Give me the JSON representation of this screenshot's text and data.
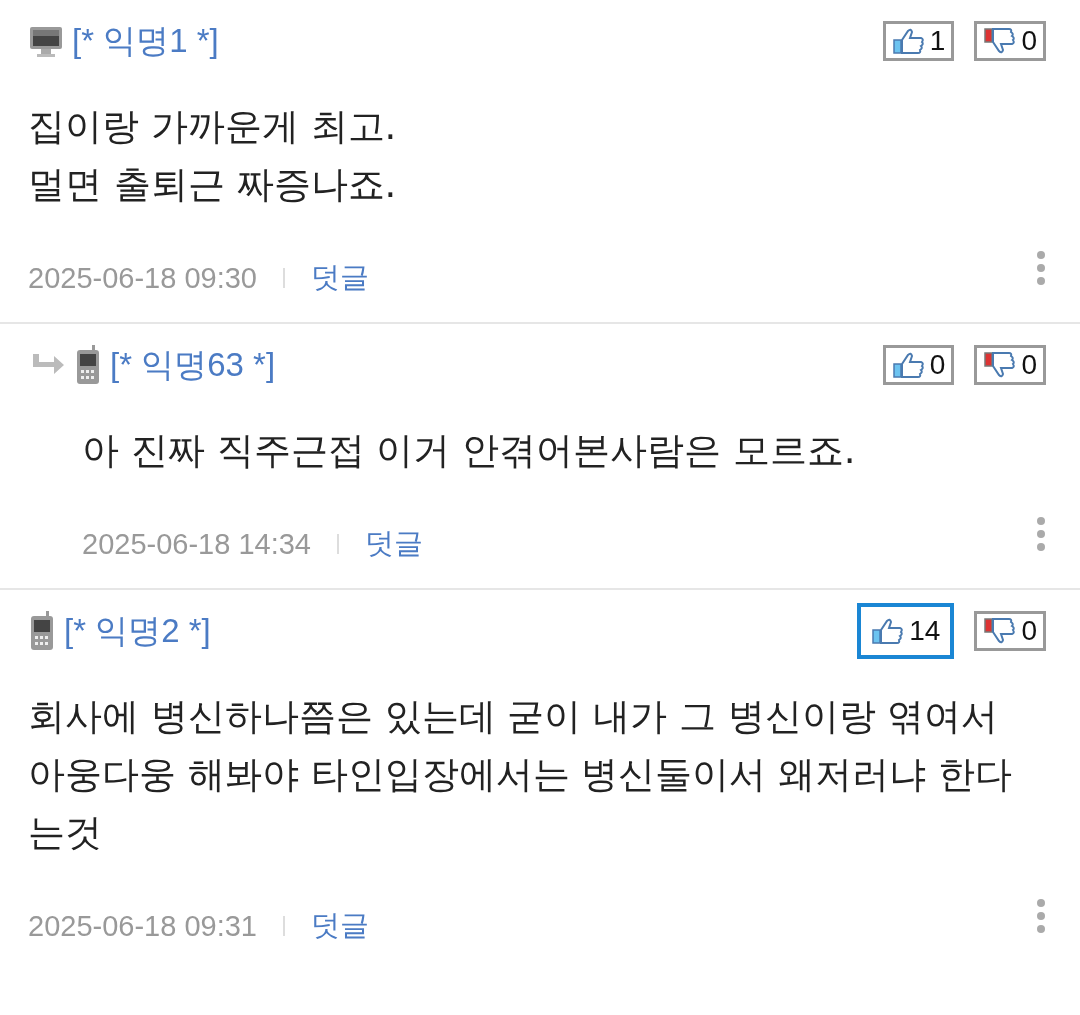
{
  "comments": [
    {
      "kind": "comment",
      "device": {
        "kind": "pc"
      },
      "author": "[* 익명1 *]",
      "likes": {
        "count": "1",
        "selected": false
      },
      "dislikes": {
        "count": "0",
        "selected": false
      },
      "body": [
        "집이랑 가까운게 최고.",
        "멀면 출퇴근 짜증나죠."
      ],
      "date": "2025-06-18 09:30",
      "reply": "덧글"
    },
    {
      "kind": "reply",
      "device": {
        "kind": "mobile"
      },
      "author": "[* 익명63 *]",
      "likes": {
        "count": "0",
        "selected": false
      },
      "dislikes": {
        "count": "0",
        "selected": false
      },
      "body": [
        "아 진짜 직주근접 이거 안겪어본사람은 모르죠."
      ],
      "date": "2025-06-18 14:34",
      "reply": "덧글"
    },
    {
      "kind": "comment",
      "device": {
        "kind": "mobile"
      },
      "author": "[* 익명2 *]",
      "likes": {
        "count": "14",
        "selected": true
      },
      "dislikes": {
        "count": "0",
        "selected": false
      },
      "body": [
        "회사에 병신하나쯤은 있는데 굳이 내가 그 병신이랑 엮여서 아웅다웅 해봐야 타인입장에서는 병신둘이서 왜저러냐 한다는것"
      ],
      "date": "2025-06-18 09:31",
      "reply": "덧글"
    }
  ]
}
